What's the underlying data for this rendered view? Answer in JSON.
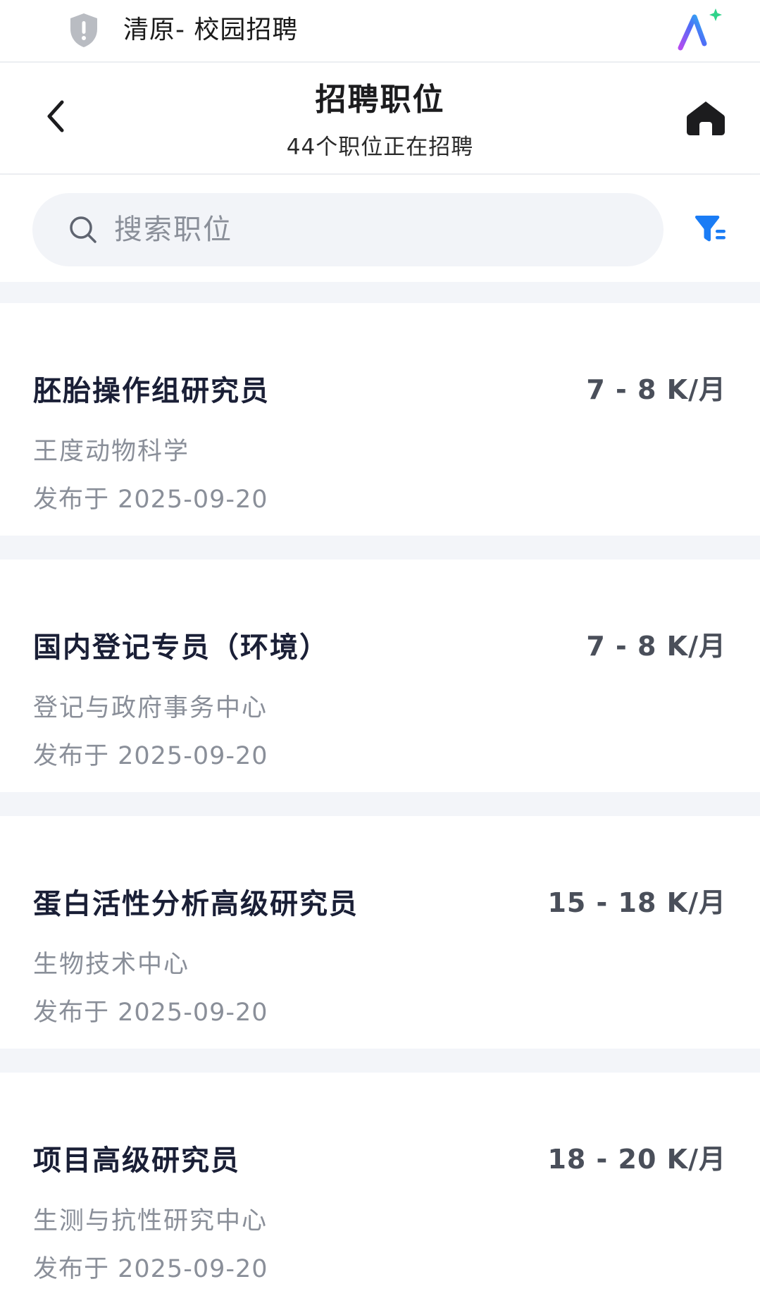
{
  "browser": {
    "site_name": "清原- 校园招聘",
    "shield_icon": "shield-alert-icon",
    "ai_icon": "ai-sparkle-icon"
  },
  "header": {
    "title": "招聘职位",
    "subtitle": "44个职位正在招聘",
    "back_icon": "chevron-left-icon",
    "home_icon": "home-icon"
  },
  "search": {
    "placeholder": "搜索职位",
    "value": "",
    "filter_icon": "filter-icon"
  },
  "colors": {
    "accent": "#1a7cf5",
    "background": "#f3f5f9",
    "title_text": "#1a1f36",
    "muted_text": "#8a8f99"
  },
  "jobs": [
    {
      "title": "胚胎操作组研究员",
      "salary": "7 - 8 K/月",
      "department": "王度动物科学",
      "date": "发布于 2025-09-20"
    },
    {
      "title": "国内登记专员（环境）",
      "salary": "7 - 8 K/月",
      "department": "登记与政府事务中心",
      "date": "发布于 2025-09-20"
    },
    {
      "title": "蛋白活性分析高级研究员",
      "salary": "15 - 18 K/月",
      "department": "生物技术中心",
      "date": "发布于 2025-09-20"
    },
    {
      "title": "项目高级研究员",
      "salary": "18 - 20 K/月",
      "department": "生测与抗性研究中心",
      "date": "发布于 2025-09-20"
    }
  ]
}
